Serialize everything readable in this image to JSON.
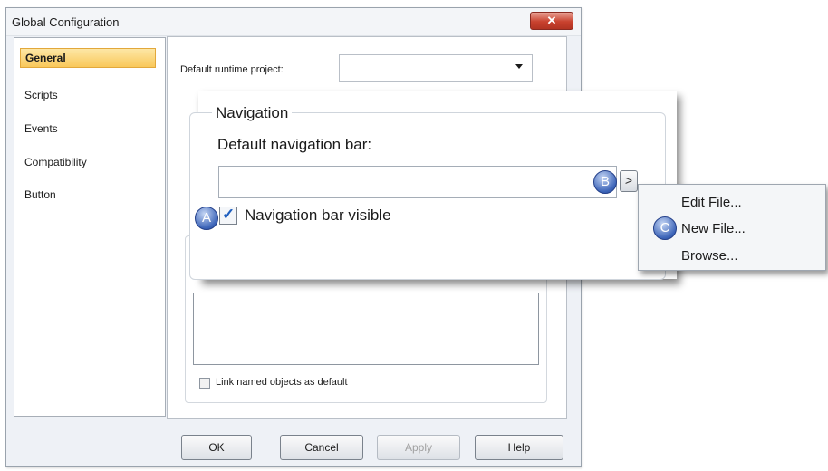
{
  "window": {
    "title": "Global Configuration"
  },
  "sidebar": {
    "items": [
      {
        "label": "General"
      },
      {
        "label": "Scripts"
      },
      {
        "label": "Events"
      },
      {
        "label": "Compatibility"
      },
      {
        "label": "Button"
      }
    ]
  },
  "runtime": {
    "label": "Default runtime project:",
    "value": ""
  },
  "navigation": {
    "group_title": "Navigation",
    "bar_label": "Default navigation bar:",
    "bar_value": "",
    "expand_label": ">",
    "visible_label": "Navigation bar visible",
    "visible_checked": true
  },
  "context_menu": {
    "items": [
      "Edit File...",
      "New File...",
      "Browse..."
    ]
  },
  "callouts": {
    "a": "A",
    "b": "B",
    "c": "C"
  },
  "link_named": {
    "label": "Link named objects as default",
    "checked": false
  },
  "buttons": {
    "ok": "OK",
    "cancel": "Cancel",
    "apply": "Apply",
    "help": "Help"
  },
  "icons": {
    "close": "close-icon",
    "dropdown": "chevron-down-icon",
    "check": "checkmark-icon"
  },
  "colors": {
    "accent": "#f9c85a",
    "close": "#c9422f",
    "callout": "#3c64b8"
  }
}
